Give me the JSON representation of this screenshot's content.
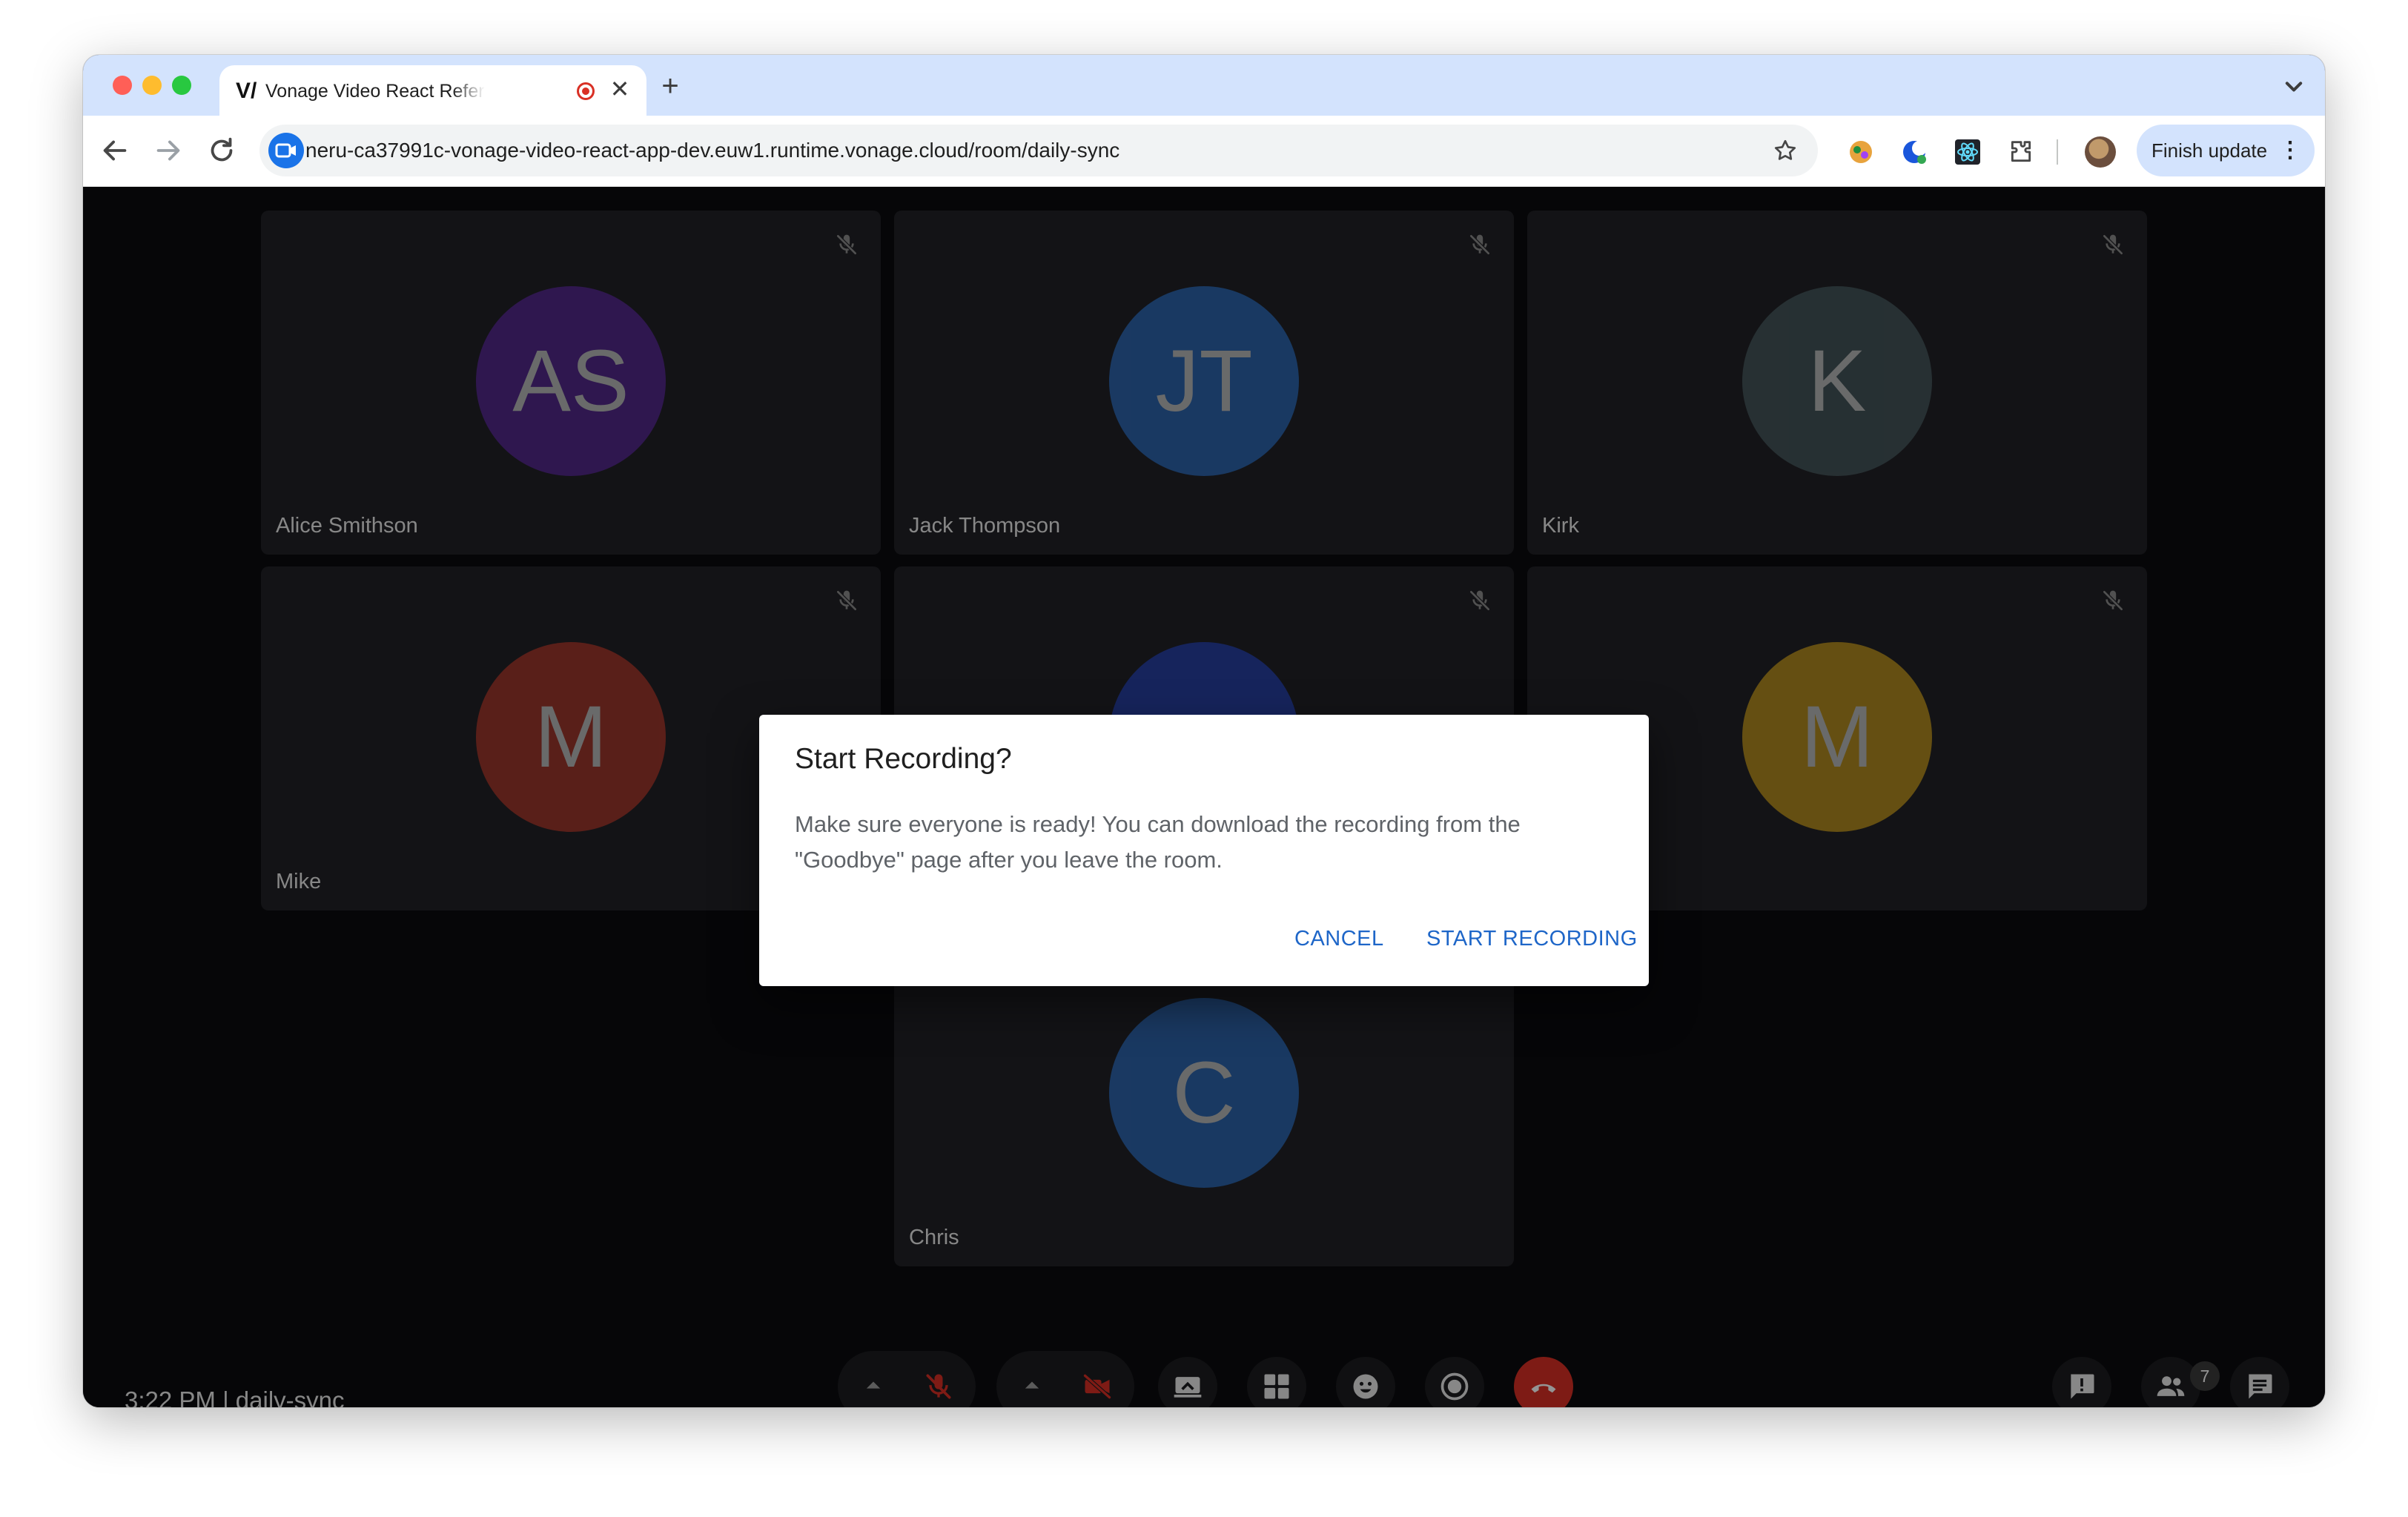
{
  "browser": {
    "tab_title": "Vonage Video React Reference App",
    "tab_favicon_glyph": "V/",
    "url": "neru-ca37991c-vonage-video-react-app-dev.euw1.runtime.vonage.cloud/room/daily-sync",
    "finish_update_label": "Finish update",
    "menu_glyph": "⋮",
    "new_tab_glyph": "+",
    "close_glyph": "✕"
  },
  "participants": [
    {
      "name": "Alice Smithson",
      "initials": "AS",
      "color": "#5b2a9a"
    },
    {
      "name": "Jack Thompson",
      "initials": "JT",
      "color": "#2f6fc1"
    },
    {
      "name": "Kirk",
      "initials": "K",
      "color": "#4a5d63"
    },
    {
      "name": "Mike",
      "initials": "M",
      "color": "#b03a2e"
    },
    {
      "name": "",
      "initials": "",
      "color": "#2844b5"
    },
    {
      "name": "",
      "initials": "M",
      "color": "#c79a1e"
    },
    {
      "name": "Chris",
      "initials": "C",
      "color": "#2f6fc1"
    }
  ],
  "status": {
    "text": "3:22 PM | daily-sync"
  },
  "controls": {
    "participant_count": "7"
  },
  "dialog": {
    "title": "Start Recording?",
    "body": "Make sure everyone is ready! You can download the recording from the \"Goodbye\" page after you leave the room.",
    "cancel_label": "CANCEL",
    "start_label": "START RECORDING"
  },
  "colors": {
    "accent_link": "#1e66c8",
    "hangup_red": "#d93025",
    "tab_strip": "#d3e3fd"
  }
}
